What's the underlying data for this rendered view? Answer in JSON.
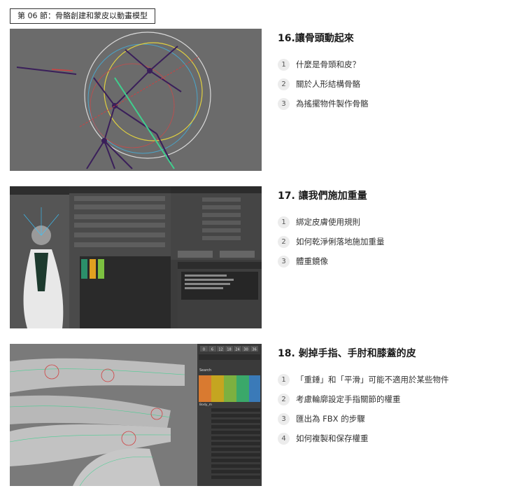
{
  "header": {
    "badge": "第 06 節：骨骼創建和蒙皮以動畫模型"
  },
  "sections": [
    {
      "title": "16.讓骨頭動起來",
      "items": [
        {
          "num": "1",
          "text": "什麼是骨頭和皮？"
        },
        {
          "num": "2",
          "text": "關於人形結構骨骼"
        },
        {
          "num": "3",
          "text": "為搖擺物件製作骨骼"
        }
      ]
    },
    {
      "title": "17. 讓我們施加重量",
      "items": [
        {
          "num": "1",
          "text": "綁定皮膚使用規則"
        },
        {
          "num": "2",
          "text": "如何乾淨俐落地施加重量"
        },
        {
          "num": "3",
          "text": "體重鏡像"
        }
      ]
    },
    {
      "title": "18. 剝掉手指、手肘和膝蓋的皮",
      "items": [
        {
          "num": "1",
          "text": "「重錘」和「平滑」可能不適用於某些物件"
        },
        {
          "num": "2",
          "text": "考慮輪廓設定手指關節的權重"
        },
        {
          "num": "3",
          "text": "匯出為 FBX 的步驟"
        },
        {
          "num": "4",
          "text": "如何複製和保存權重"
        }
      ]
    }
  ],
  "screenshots": {
    "s1": {
      "icon": "skeleton-rig-viewport"
    },
    "s2": {
      "icon": "weight-paint-editor-windows"
    },
    "s3": {
      "icon": "hand-weight-table",
      "frames": [
        "0",
        "6",
        "12",
        "18",
        "24",
        "30",
        "36"
      ],
      "search_label": "Search",
      "row_label": "Body_m"
    }
  },
  "colors": {
    "viewport_bg": "#6b6b6b",
    "dark_panel": "#444444",
    "bone": "#3a1f5a",
    "accent_green": "#3fcf8e"
  }
}
